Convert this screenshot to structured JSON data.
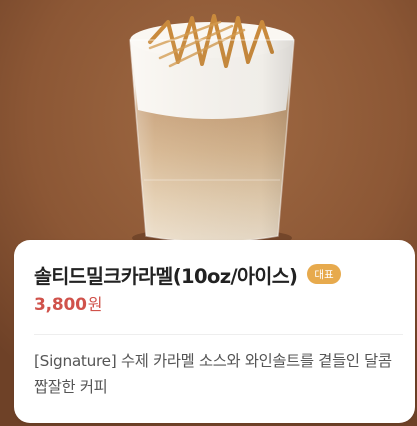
{
  "product": {
    "image_alt": "솔티드밀크카라멜 iced drink",
    "name": "솔티드밀크카라멜(10oz/아이스)",
    "badge": "대표",
    "price": "3,800",
    "price_unit": "원",
    "description": "[Signature] 수제 카라멜 소스와 와인솔트를 곁들인 달콤 짭잘한 커피"
  },
  "colors": {
    "background": "#8b5a3b",
    "badge": "#e7aa4d",
    "price": "#d0524b",
    "title": "#222222",
    "description": "#555555"
  }
}
